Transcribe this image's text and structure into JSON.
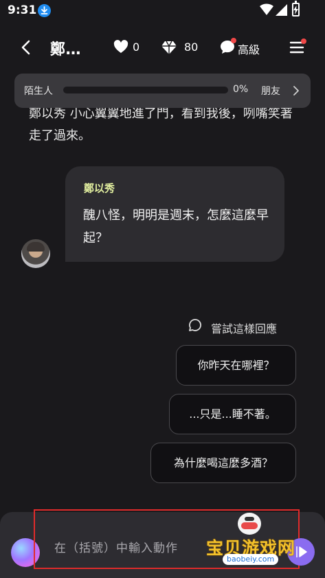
{
  "status_bar": {
    "time": "9:31",
    "icons": [
      "download-icon",
      "wifi-icon",
      "signal-icon",
      "battery-charging-icon"
    ]
  },
  "header": {
    "title": "鄭…",
    "hearts": "0",
    "gems": "80",
    "tier_label": "高級",
    "colors": {
      "notification_dot": "#f04848"
    }
  },
  "relationship": {
    "left_label": "陌生人",
    "progress_fraction": 0.0,
    "percent_text": "0%",
    "right_label": "朋友"
  },
  "conversation": {
    "narration": "鄭以秀 小心翼翼地進了門，看到我後，咧嘴笑著走了過來。",
    "message": {
      "speaker": "鄭以秀",
      "text": "醜八怪，明明是週末，怎麼這麼早起？",
      "name_color": "#e3f0a0"
    }
  },
  "suggestions": {
    "heading": "嘗試這樣回應",
    "options": [
      "你昨天在哪裡？",
      "...只是...睡不著。",
      "為什麼喝這麼多酒？"
    ]
  },
  "composer": {
    "placeholder": "在（括號）中輸入動作",
    "highlight_color": "#e02b2b",
    "send_color": "#8a6cf0"
  },
  "watermark": {
    "text": "宝贝游戏网",
    "url": "baobeiy.com"
  }
}
